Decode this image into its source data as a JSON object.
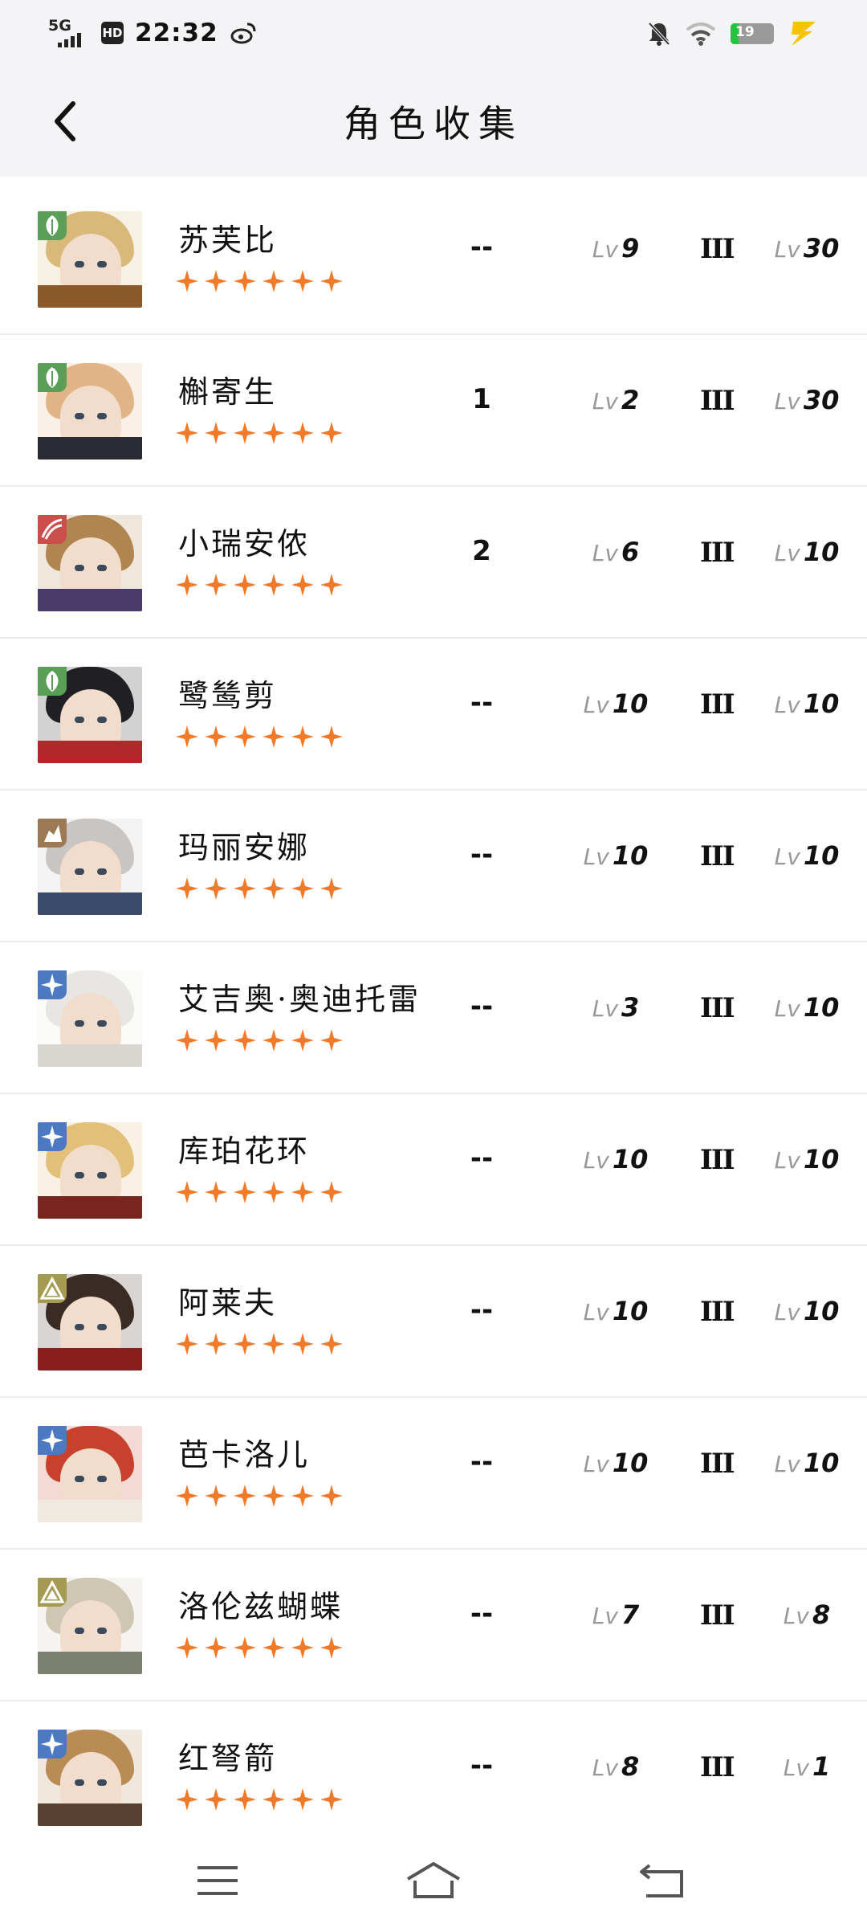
{
  "status_bar": {
    "network": "5G",
    "hd": "HD",
    "time": "22:32",
    "battery": "19",
    "battery_fraction": 0.19,
    "icons": [
      "signal-icon",
      "weibo-icon",
      "bell-off-icon",
      "wifi-icon",
      "battery-icon",
      "charging-bolt-icon"
    ]
  },
  "header": {
    "title": "角色收集",
    "back_icon": "chevron-left-icon"
  },
  "colors": {
    "star": "#f07a2a",
    "element_green": "#5a9e57",
    "element_red": "#c94f4a",
    "element_brown": "#9c7a55",
    "element_blue": "#4c79c2",
    "element_olive": "#a49a52"
  },
  "characters": [
    {
      "name": "苏芙比",
      "element": "green",
      "stars": 6,
      "c": "--",
      "lv_prefix": "Lv",
      "level": "9",
      "tier": "III",
      "lv2_prefix": "Lv",
      "level2": "30"
    },
    {
      "name": "槲寄生",
      "element": "green",
      "stars": 6,
      "c": "1",
      "lv_prefix": "Lv",
      "level": "2",
      "tier": "III",
      "lv2_prefix": "Lv",
      "level2": "30"
    },
    {
      "name": "小瑞安侬",
      "element": "red",
      "stars": 6,
      "c": "2",
      "lv_prefix": "Lv",
      "level": "6",
      "tier": "III",
      "lv2_prefix": "Lv",
      "level2": "10"
    },
    {
      "name": "鹭鸶剪",
      "element": "green",
      "stars": 6,
      "c": "--",
      "lv_prefix": "Lv",
      "level": "10",
      "tier": "III",
      "lv2_prefix": "Lv",
      "level2": "10"
    },
    {
      "name": "玛丽安娜",
      "element": "brown",
      "stars": 6,
      "c": "--",
      "lv_prefix": "Lv",
      "level": "10",
      "tier": "III",
      "lv2_prefix": "Lv",
      "level2": "10"
    },
    {
      "name": "艾吉奥·奥迪托雷",
      "element": "blue",
      "stars": 6,
      "c": "--",
      "lv_prefix": "Lv",
      "level": "3",
      "tier": "III",
      "lv2_prefix": "Lv",
      "level2": "10"
    },
    {
      "name": "库珀花环",
      "element": "blue",
      "stars": 6,
      "c": "--",
      "lv_prefix": "Lv",
      "level": "10",
      "tier": "III",
      "lv2_prefix": "Lv",
      "level2": "10"
    },
    {
      "name": "阿莱夫",
      "element": "olive",
      "stars": 6,
      "c": "--",
      "lv_prefix": "Lv",
      "level": "10",
      "tier": "III",
      "lv2_prefix": "Lv",
      "level2": "10"
    },
    {
      "name": "芭卡洛儿",
      "element": "blue",
      "stars": 6,
      "c": "--",
      "lv_prefix": "Lv",
      "level": "10",
      "tier": "III",
      "lv2_prefix": "Lv",
      "level2": "10"
    },
    {
      "name": "洛伦兹蝴蝶",
      "element": "olive",
      "stars": 6,
      "c": "--",
      "lv_prefix": "Lv",
      "level": "7",
      "tier": "III",
      "lv2_prefix": "Lv",
      "level2": "8"
    },
    {
      "name": "红弩箭",
      "element": "blue",
      "stars": 6,
      "c": "--",
      "lv_prefix": "Lv",
      "level": "8",
      "tier": "III",
      "lv2_prefix": "Lv",
      "level2": "1"
    }
  ],
  "bottom_nav": [
    "menu-icon",
    "home-icon",
    "back-return-icon"
  ]
}
